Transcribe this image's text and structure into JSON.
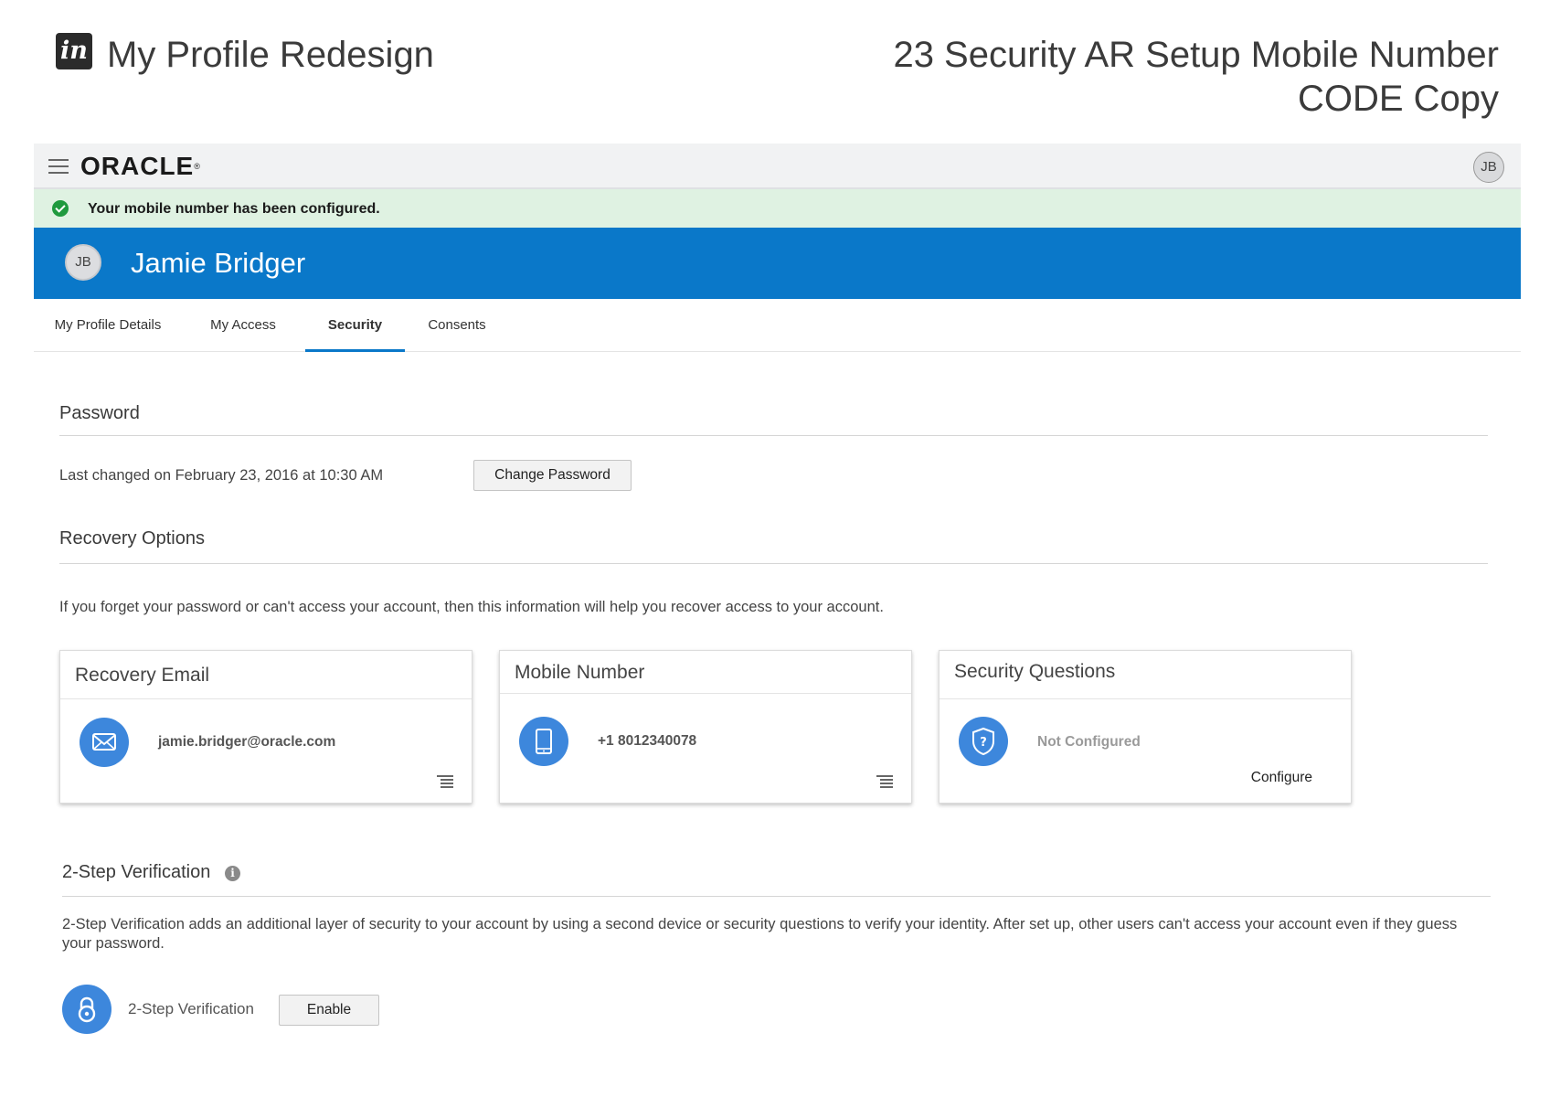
{
  "inv": {
    "logo_text": "in",
    "project_title": "My Profile Redesign",
    "screen_title": "23 Security AR Setup Mobile Number CODE Copy"
  },
  "topbar": {
    "brand": "ORACLE",
    "avatar_initials": "JB"
  },
  "notice": {
    "message": "Your mobile number has been configured.",
    "color": "#1f9a3e"
  },
  "banner": {
    "avatar_initials": "JB",
    "user_name": "Jamie Bridger",
    "color": "#0a78c9"
  },
  "tabs": [
    {
      "label": "My Profile Details"
    },
    {
      "label": "My Access"
    },
    {
      "label": "Security",
      "active": true
    },
    {
      "label": "Consents"
    }
  ],
  "password": {
    "title": "Password",
    "last_changed": "Last changed on February 23, 2016 at 10:30 AM",
    "button_label": "Change Password"
  },
  "recovery": {
    "title": "Recovery Options",
    "description": "If you forget your password or can't access your account, then this information will help you recover access to your account.",
    "cards": [
      {
        "title": "Recovery Email",
        "value": "jamie.bridger@oracle.com",
        "icon": "envelope-icon"
      },
      {
        "title": "Mobile Number",
        "value": "+1 8012340078",
        "icon": "mobile-phone-icon"
      },
      {
        "title": "Security Questions",
        "value": "Not Configured",
        "icon": "shield-question-icon",
        "action": "Configure"
      }
    ]
  },
  "two_step": {
    "title": "2-Step Verification",
    "info_glyph": "i",
    "description": "2-Step Verification adds an additional layer of security to your account by using a second device or security questions to verify your identity. After set up, other users can't access your account even if they guess your password.",
    "row_label": "2-Step Verification",
    "button_label": "Enable",
    "icon": "lock-icon"
  }
}
